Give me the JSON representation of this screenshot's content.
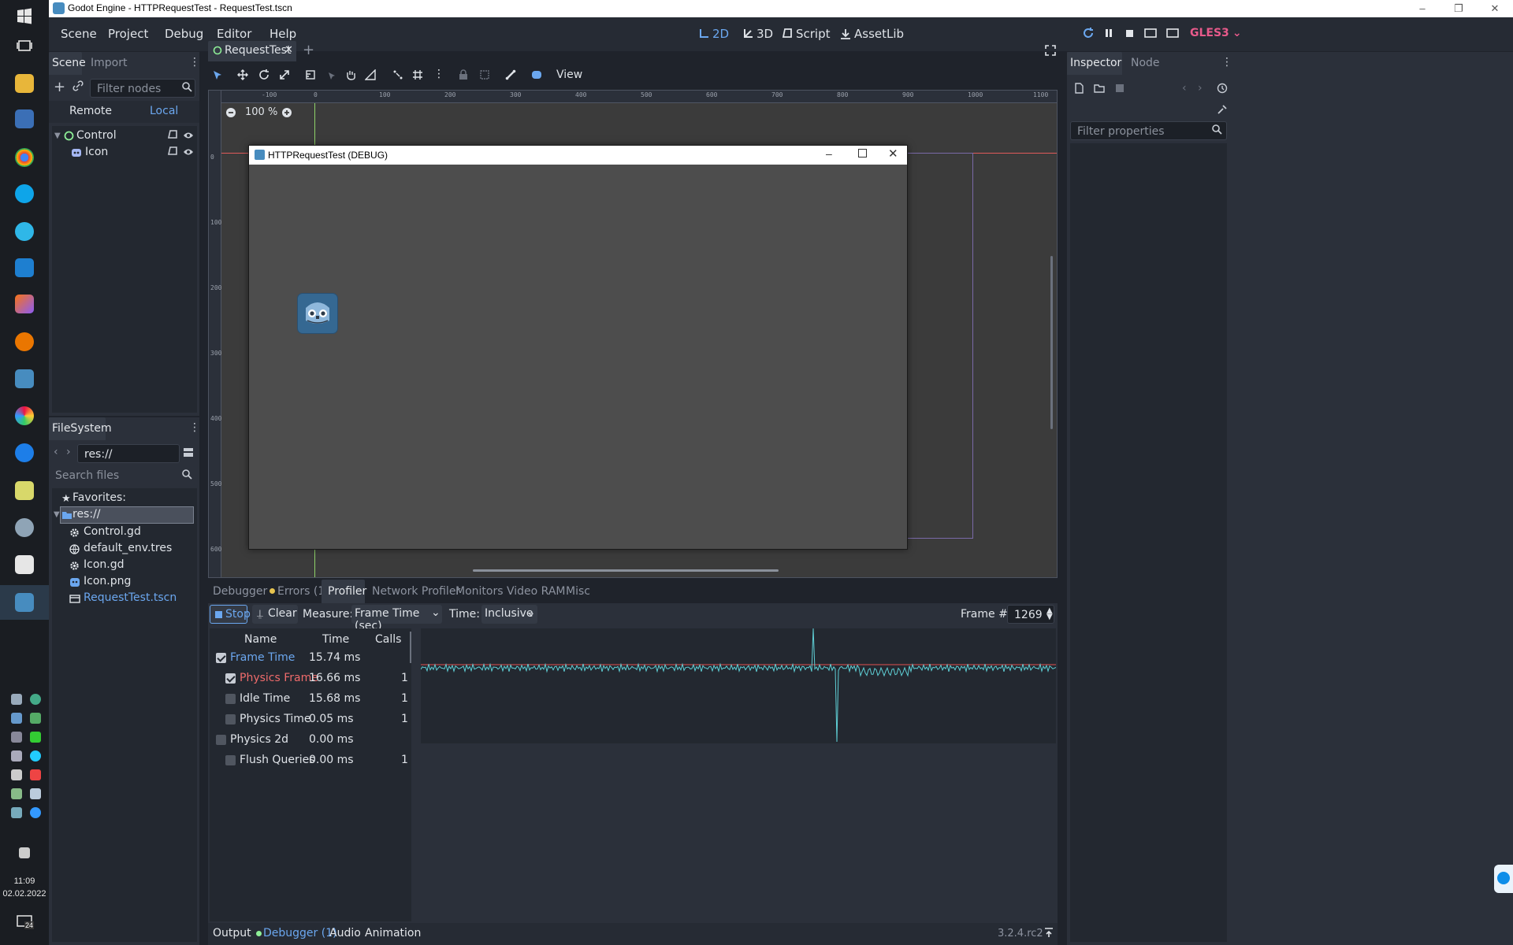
{
  "os_window": {
    "title": "Godot Engine - HTTPRequestTest - RequestTest.tscn",
    "minimize": "–",
    "restore": "❐",
    "close": "✕"
  },
  "taskbar": {
    "time": "11:09",
    "date": "02.02.2022",
    "notification_count": "24"
  },
  "menubar": {
    "menus": [
      "Scene",
      "Project",
      "Debug",
      "Editor",
      "Help"
    ],
    "modes": [
      "2D",
      "3D",
      "Script",
      "AssetLib"
    ],
    "active_mode": "2D",
    "renderer": "GLES3"
  },
  "scene_dock": {
    "tabs": [
      "Scene",
      "Import"
    ],
    "filter_placeholder": "Filter nodes",
    "remote": "Remote",
    "local": "Local",
    "nodes": [
      {
        "name": "Control",
        "icon": "control-node-icon"
      },
      {
        "name": "Icon",
        "icon": "sprite-node-icon"
      }
    ]
  },
  "filesystem": {
    "title": "FileSystem",
    "path": "res://",
    "search_placeholder": "Search files",
    "favorites": "Favorites:",
    "root": "res://",
    "files": [
      {
        "name": "Control.gd",
        "icon": "gear-icon"
      },
      {
        "name": "default_env.tres",
        "icon": "globe-icon"
      },
      {
        "name": "Icon.gd",
        "icon": "gear-icon"
      },
      {
        "name": "Icon.png",
        "icon": "image-icon"
      },
      {
        "name": "RequestTest.tscn",
        "icon": "scene-icon"
      }
    ]
  },
  "scene_tab": {
    "name": "RequestTest",
    "add": "+"
  },
  "canvas_toolbar": {
    "view": "View",
    "zoom": "100 %"
  },
  "rulers": {
    "h_labels": [
      "-100",
      "0",
      "100",
      "200",
      "300",
      "400",
      "500",
      "600",
      "700",
      "800",
      "900",
      "1000",
      "1100"
    ],
    "v_labels": [
      "0",
      "100",
      "200",
      "300",
      "400",
      "500",
      "600"
    ]
  },
  "debug_window": {
    "title": "HTTPRequestTest (DEBUG)"
  },
  "inspector": {
    "tabs": [
      "Inspector",
      "Node"
    ],
    "filter_placeholder": "Filter properties"
  },
  "bottom_panel": {
    "tabs": [
      "Debugger",
      "Errors (1)",
      "Profiler",
      "Network Profiler",
      "Monitors",
      "Video RAM",
      "Misc"
    ],
    "active_tab": "Profiler",
    "stop": "Stop",
    "clear": "Clear",
    "measure_label": "Measure:",
    "measure_value": "Frame Time (sec)",
    "time_label": "Time:",
    "time_value": "Inclusive",
    "frame_label": "Frame #:",
    "frame_value": "1269",
    "columns": [
      "Name",
      "Time",
      "Calls"
    ],
    "rows": [
      {
        "name": "Frame Time",
        "time": "15.74 ms",
        "calls": "",
        "checked": true,
        "color": "#6ba7ef",
        "indent": 0
      },
      {
        "name": "Physics Frame",
        "time": "16.66 ms",
        "calls": "1",
        "checked": true,
        "color": "#ef6b6b",
        "indent": 1
      },
      {
        "name": "Idle Time",
        "time": "15.68 ms",
        "calls": "1",
        "checked": false,
        "color": "#dfe3e8",
        "indent": 1
      },
      {
        "name": "Physics Time",
        "time": "0.05 ms",
        "calls": "1",
        "checked": false,
        "color": "#dfe3e8",
        "indent": 1
      },
      {
        "name": "Physics 2d",
        "time": "0.00 ms",
        "calls": "",
        "checked": false,
        "color": "#dfe3e8",
        "indent": 0
      },
      {
        "name": "Flush Queries",
        "time": "0.00 ms",
        "calls": "1",
        "checked": false,
        "color": "#dfe3e8",
        "indent": 1
      }
    ],
    "status_tabs": [
      "Output",
      "Debugger (1)",
      "Audio",
      "Animation"
    ],
    "version": "3.2.4.rc2"
  },
  "colors": {
    "accent": "#6ba7ef",
    "graph_line": "#5fd0d6",
    "graph_ref": "#e05050"
  }
}
